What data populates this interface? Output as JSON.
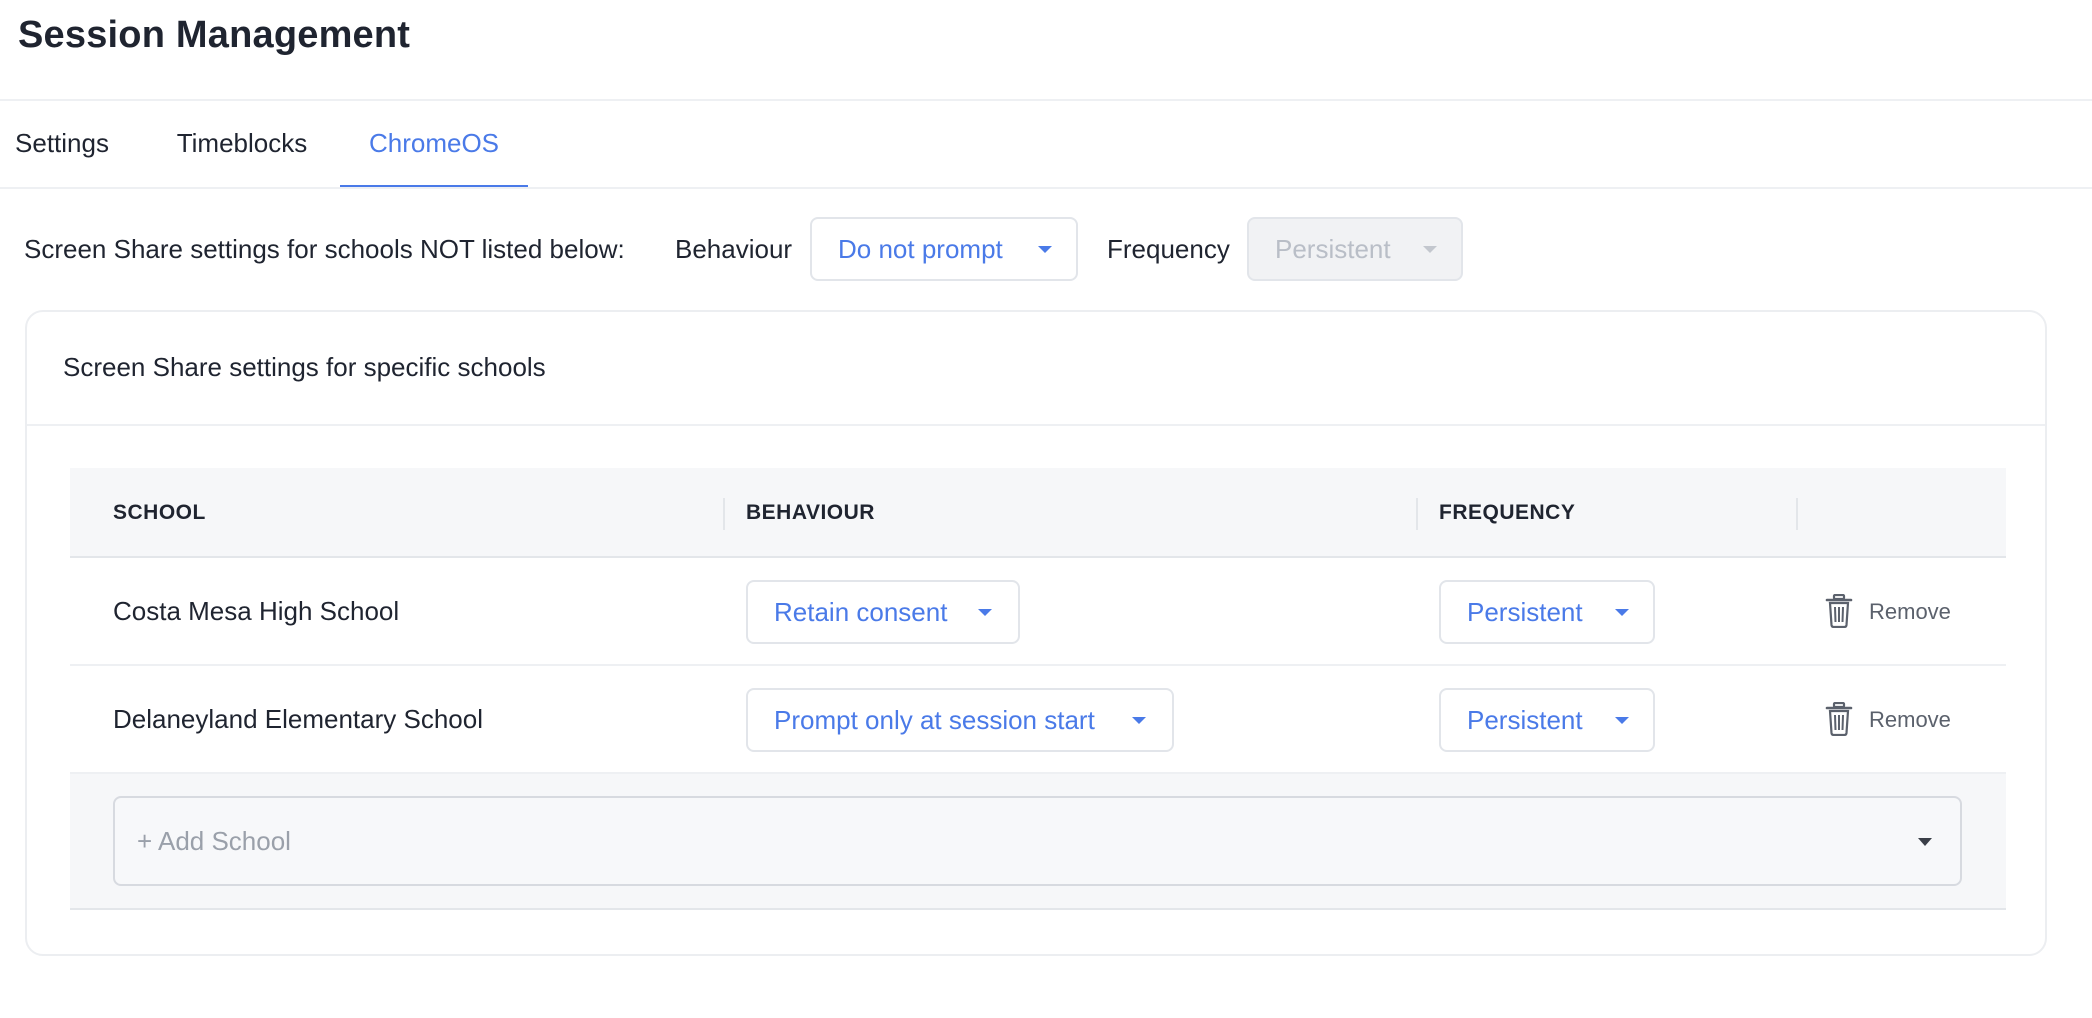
{
  "page": {
    "title": "Session Management"
  },
  "tabs": [
    {
      "label": "Settings"
    },
    {
      "label": "Timeblocks"
    },
    {
      "label": "ChromeOS"
    }
  ],
  "global_settings": {
    "label": "Screen Share settings for schools NOT listed below:",
    "behaviour_label": "Behaviour",
    "behaviour_value": "Do not prompt",
    "frequency_label": "Frequency",
    "frequency_value": "Persistent",
    "frequency_disabled": true
  },
  "card": {
    "title": "Screen Share settings for specific schools"
  },
  "table": {
    "headers": [
      "SCHOOL",
      "BEHAVIOUR",
      "FREQUENCY"
    ],
    "rows": [
      {
        "school": "Costa Mesa High School",
        "behaviour": "Retain consent",
        "frequency": "Persistent",
        "remove_label": "Remove"
      },
      {
        "school": "Delaneyland Elementary School",
        "behaviour": "Prompt only at session start",
        "frequency": "Persistent",
        "remove_label": "Remove"
      }
    ],
    "add_placeholder": "+ Add School"
  },
  "colors": {
    "accent": "#4a7ae8",
    "text": "#1f2430",
    "muted": "#5b616c",
    "header_bg": "#f6f7f9"
  },
  "icons": {
    "remove": "trash-icon",
    "dropdown": "chevron-down-icon"
  }
}
